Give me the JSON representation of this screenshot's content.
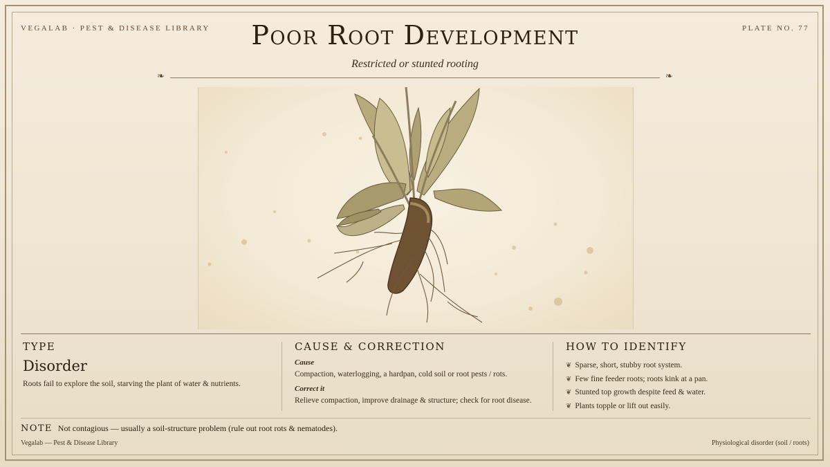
{
  "header": {
    "library_label": "VEGALAB · PEST & DISEASE LIBRARY",
    "plate_number": "PLATE NO. 77",
    "title": "Poor Root Development",
    "subtitle": "Restricted or stunted rooting"
  },
  "illustration": {
    "icon": "root-plant-illustration"
  },
  "type_section": {
    "heading": "TYPE",
    "value": "Disorder",
    "description": "Roots fail to explore the soil, starving the plant of water & nutrients."
  },
  "cause_section": {
    "heading": "CAUSE & CORRECTION",
    "cause_label": "Cause",
    "cause_text": "Compaction, waterlogging, a hardpan, cold soil or root pests / rots.",
    "correct_label": "Correct it",
    "correct_text": "Relieve compaction, improve drainage & structure; check for root disease."
  },
  "identify_section": {
    "heading": "HOW TO IDENTIFY",
    "items": [
      "Sparse, short, stubby root system.",
      "Few fine feeder roots; roots kink at a pan.",
      "Stunted top growth despite feed & water.",
      "Plants topple or lift out easily."
    ]
  },
  "note": {
    "label": "NOTE",
    "text": "Not contagious — usually a soil-structure problem (rule out root rots & nematodes)."
  },
  "footer": {
    "left": "Vegalab — Pest & Disease Library",
    "right": "Physiological disorder (soil / roots)"
  },
  "colors": {
    "background": "#efe5d2",
    "ink": "#2c2014",
    "rule": "#8a7a5e"
  }
}
